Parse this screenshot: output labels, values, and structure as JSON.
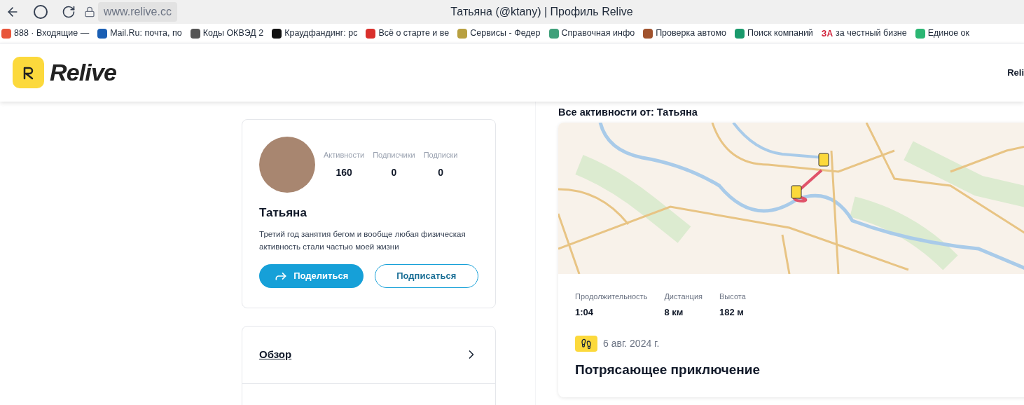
{
  "browser": {
    "url": "www.relive.cc",
    "title": "Татьяна (@ktany) | Профиль Relive",
    "bookmarks": [
      {
        "label": "888 · Входящие —",
        "color": "#e8553a"
      },
      {
        "label": "Mail.Ru: почта, по",
        "color": "#1a5fb4"
      },
      {
        "label": "Коды ОКВЭД 2",
        "color": "#555555"
      },
      {
        "label": "Краудфандинг: рс",
        "color": "#111111"
      },
      {
        "label": "Всё о старте и ве",
        "color": "#d9302c"
      },
      {
        "label": "Сервисы - Федер",
        "color": "#b8a040"
      },
      {
        "label": "Справочная инфо",
        "color": "#3fa07a"
      },
      {
        "label": "Проверка автомо",
        "color": "#a0522d"
      },
      {
        "label": "Поиск компаний",
        "color": "#1a9a6c"
      },
      {
        "label": "за честный бизне",
        "color": "#d0213a",
        "icon_text": "ЗА"
      },
      {
        "label": "Единое ок",
        "color": "#2bb673"
      }
    ]
  },
  "header": {
    "brand": "Relive",
    "nav_cut": "Reli"
  },
  "profile": {
    "stats": [
      {
        "label": "Активности",
        "value": "160"
      },
      {
        "label": "Подписчики",
        "value": "0"
      },
      {
        "label": "Подписки",
        "value": "0"
      }
    ],
    "name": "Татьяна",
    "bio": "Третий год занятия бегом и вообще любая физическая активность стали частью моей жизни",
    "share_button": "Поделиться",
    "follow_button": "Подписаться"
  },
  "menu_items": [
    {
      "label": "Обзор",
      "selected": true
    }
  ],
  "feed": {
    "heading": "Все активности от: Татьяна",
    "activity": {
      "stats": [
        {
          "label": "Продолжительность",
          "value": "1:04"
        },
        {
          "label": "Дистанция",
          "value": "8 км"
        },
        {
          "label": "Высота",
          "value": "182 м"
        }
      ],
      "date": "6 авг. 2024 г.",
      "title": "Потрясающее приключение"
    }
  }
}
